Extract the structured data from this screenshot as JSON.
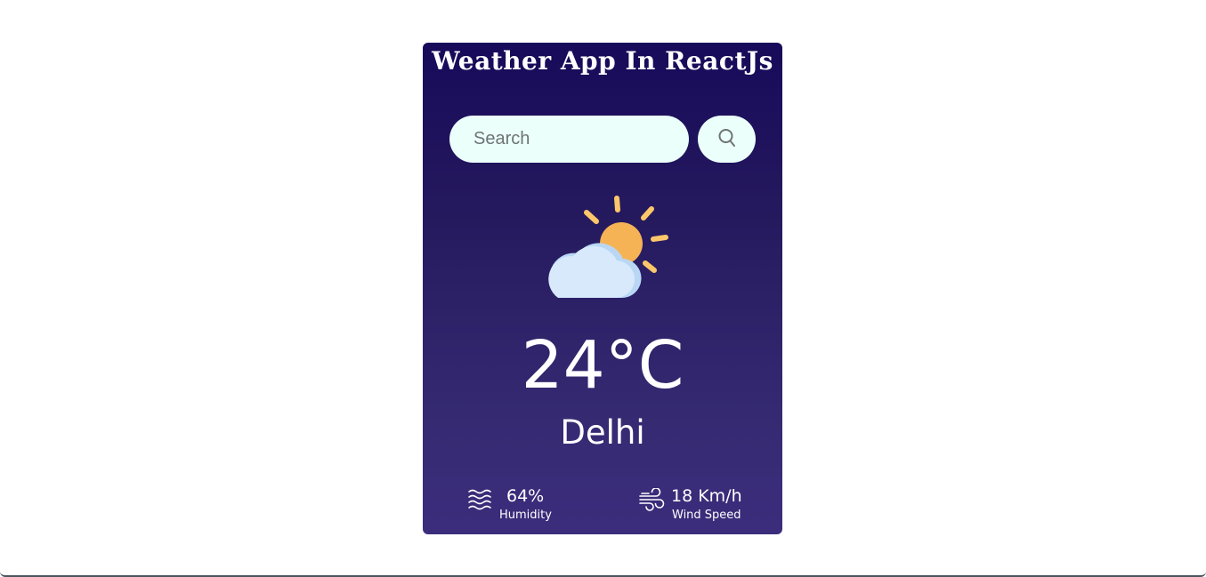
{
  "app": {
    "title": "Weather App In ReactJs"
  },
  "search": {
    "placeholder": "Search",
    "value": "",
    "button_icon": "search-icon"
  },
  "weather": {
    "icon": "partly-cloudy-icon",
    "temperature": "24°C",
    "city": "Delhi"
  },
  "stats": {
    "humidity": {
      "icon": "humidity-icon",
      "value": "64%",
      "label": "Humidity"
    },
    "wind": {
      "icon": "wind-icon",
      "value": "18 Km/h",
      "label": "Wind Speed"
    }
  },
  "colors": {
    "card_top": "#170a5a",
    "card_bottom": "#3c2d7c",
    "input_bg": "#ebfffb",
    "sun": "#f5b356",
    "sun_rays": "#fbc76a",
    "cloud": "#d7e9fb",
    "cloud_shadow": "#b9d7f4"
  }
}
